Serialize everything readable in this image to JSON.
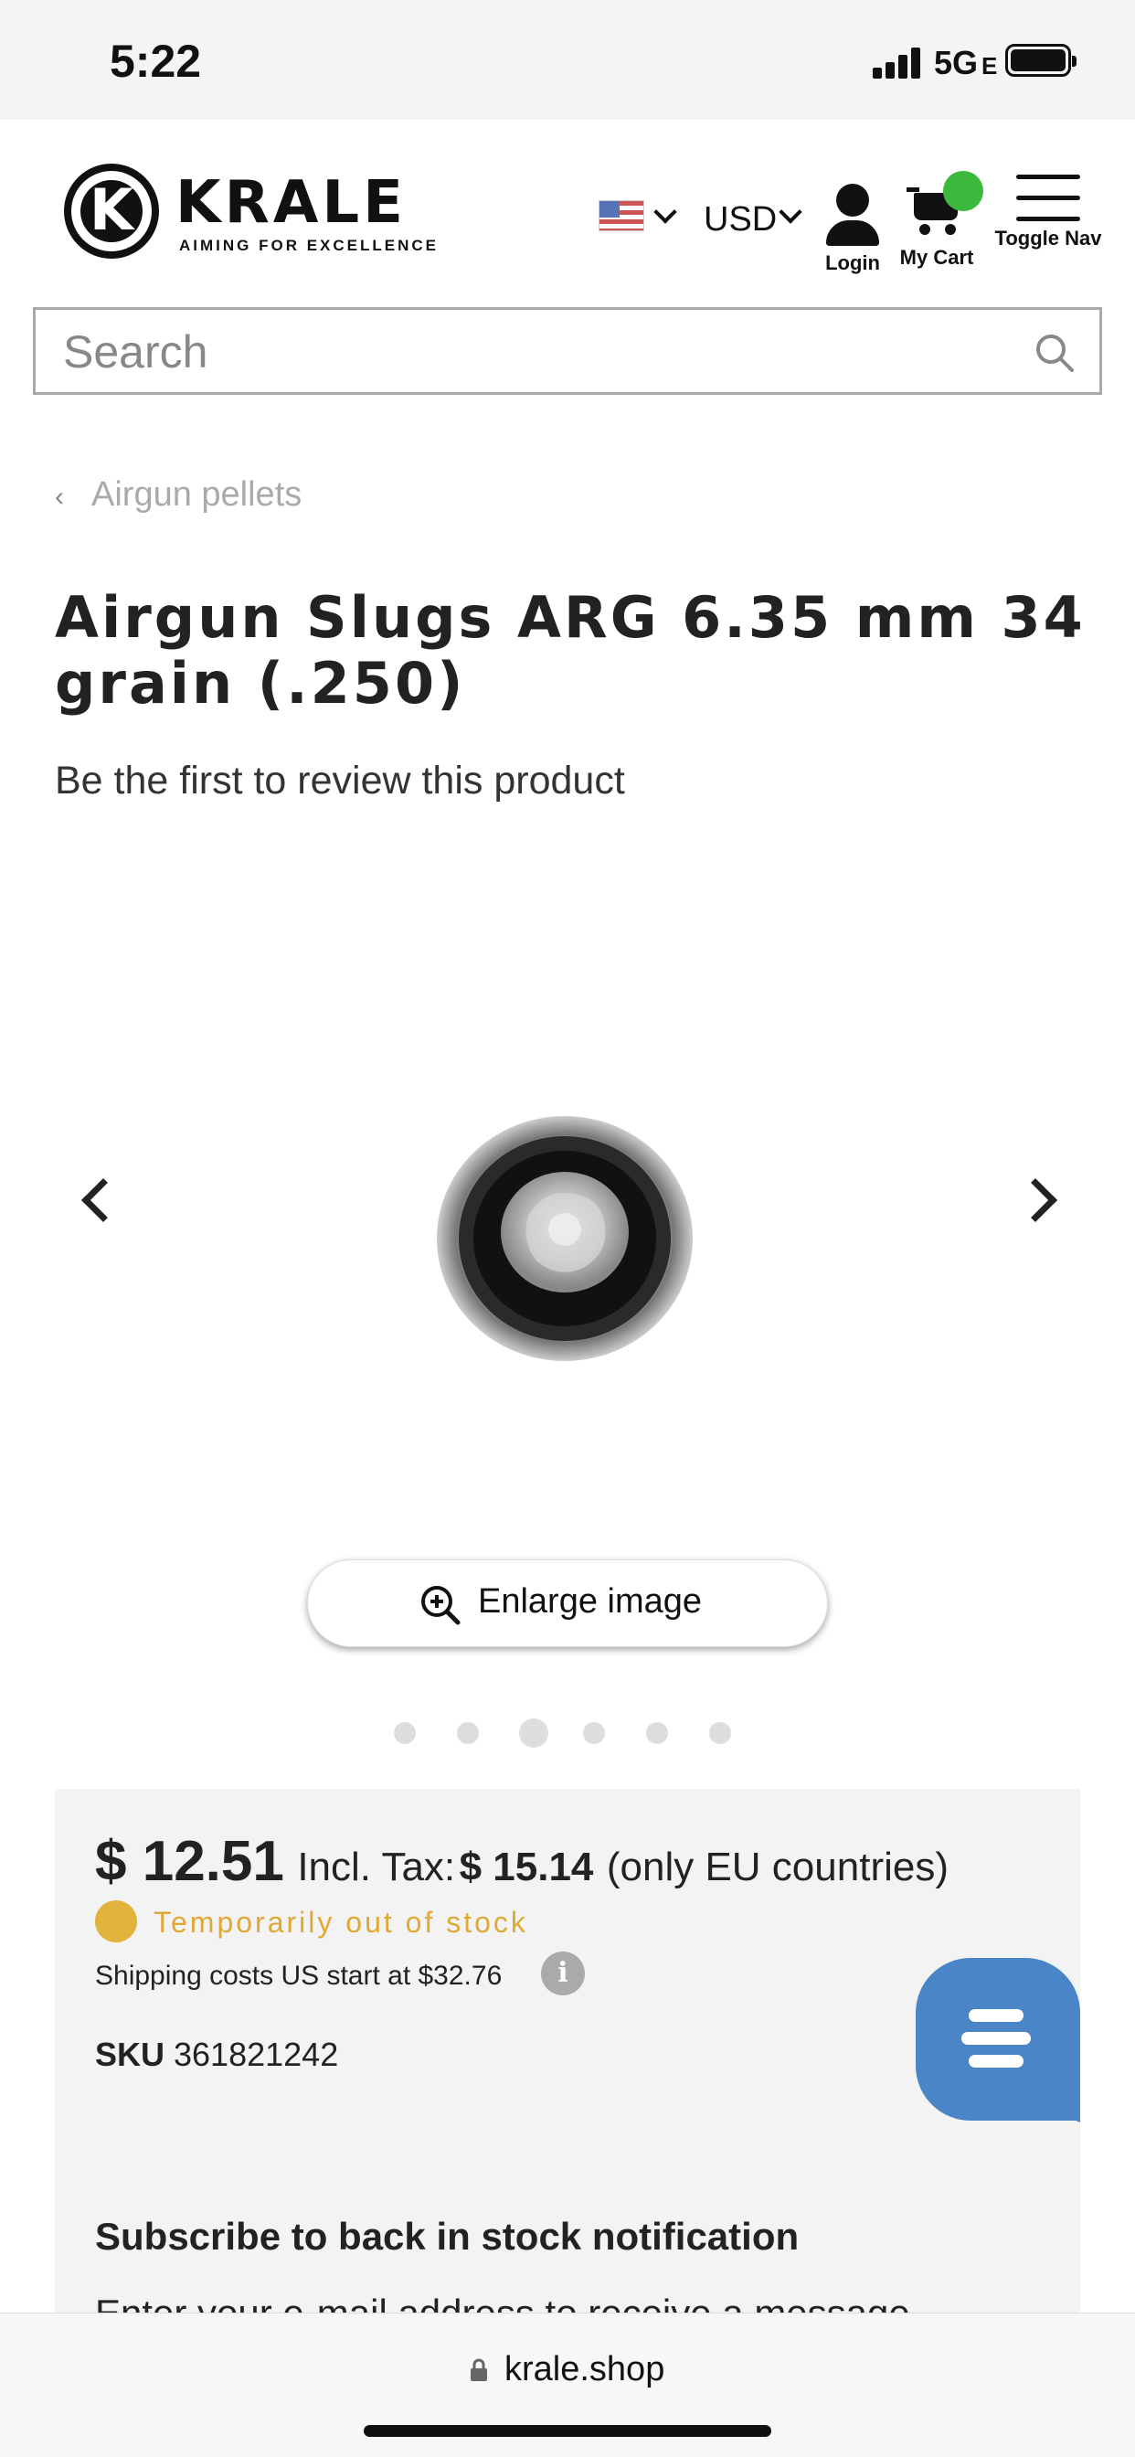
{
  "status_bar": {
    "time": "5:22",
    "network": "5G",
    "network_suffix": "E"
  },
  "header": {
    "logo_name": "KRALE",
    "logo_tagline": "AIMING FOR EXCELLENCE",
    "currency": "USD",
    "login_label": "Login",
    "cart_label": "My Cart",
    "nav_label": "Toggle Nav",
    "cart_badge_color": "#3cb83c"
  },
  "search": {
    "placeholder": "Search"
  },
  "breadcrumb": {
    "label": "Airgun pellets"
  },
  "product": {
    "title": "Airgun Slugs ARG 6.35 mm 34 grain (.250)",
    "review_text": "Be the first to review this product",
    "enlarge_label": "Enlarge image",
    "gallery_dots": 6,
    "gallery_active_index": 2
  },
  "pricing": {
    "price": "$ 12.51",
    "incl_tax_label": "Incl. Tax:",
    "incl_tax_value": "$ 15.14",
    "eu_note": "(only EU countries)",
    "stock_status": "Temporarily out of stock",
    "stock_color": "#e2b33a",
    "shipping": "Shipping costs US start at $32.76",
    "sku_label": "SKU",
    "sku_value": "361821242",
    "subscribe_title": "Subscribe to back in stock notification",
    "subscribe_desc": "Enter your e-mail address to receive a message"
  },
  "chat": {
    "color": "#4a86c7"
  },
  "browser": {
    "url": "krale.shop"
  }
}
